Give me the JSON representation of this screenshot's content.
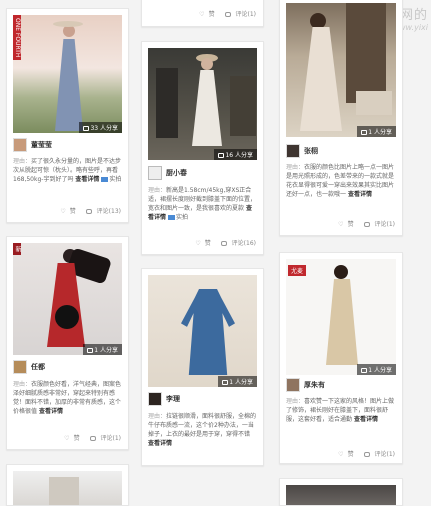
{
  "watermark": {
    "cn": "互联网的",
    "url": "www.yixi"
  },
  "cards": [
    {
      "count": "33 人分享",
      "tag": "ONE FOURTH",
      "user": "董莹莹",
      "desc_label": "理由：",
      "desc": "买了很久永分量的，图片是不达步次从脱起可惊（枕头）。略有些呼，再看168,50kg-宇到好了吗",
      "more": "查看详情",
      "pic_label": "实拍",
      "like": "赞",
      "comment": "评论(13)"
    },
    {
      "top_like": "赞",
      "top_comment": "评论(1)"
    },
    {
      "count": "1 人分享",
      "user": "张栩",
      "desc_label": "理由：",
      "desc": "衣服的颜色比图片上略一点一图片是用光照形成的，色差带来的一款式就是花衣显得很可爱一穿出来效果其实比图片还好一点，也一款哦一",
      "more": "查看详情",
      "like": "赞",
      "comment": "评论(1)"
    },
    {
      "count": "16 人分享",
      "user": "厨小春",
      "desc_label": "理由：",
      "desc": "新高是1.58cm/45kg,穿XS正合适，裙摆长度刚好截到膝盖下面的位置，宽衣和图片一致，是我很喜欢的夏款",
      "more": "查看详情",
      "pic_label": "实拍",
      "like": "赞",
      "comment": "评论(16)"
    },
    {
      "count": "1 人分享",
      "user": "任都",
      "desc_label": "理由：",
      "desc": "衣服颜色好看，洋气经典，图案色泽好细腻质感非常好，穿起来特别有感觉！面料不错，加厚的非常有质感，这个价格很值",
      "more": "查看详情",
      "like": "赞",
      "comment": "评论(1)"
    },
    {
      "count": "1 人分享",
      "user": "李理",
      "desc_label": "理由：",
      "desc": "拉链很顺滑，面料很舒服，全棉的牛仔布质感一流，这个价2种办法，一当掉子，上衣的最好是用于穿，穿得不错",
      "more": "查看详情",
      "like": "",
      "comment": ""
    },
    {
      "count": "1 人分享",
      "tag": "尤麦",
      "user": "厚朱有",
      "desc_label": "理由：",
      "desc": "喜欢赞一下这家的风格！图片上做了修饰，裙长刚好在膝盖下，面料很舒服，这套好看，适合通勤",
      "more": "查看详情",
      "like": "赞",
      "comment": "评论(1)"
    }
  ]
}
